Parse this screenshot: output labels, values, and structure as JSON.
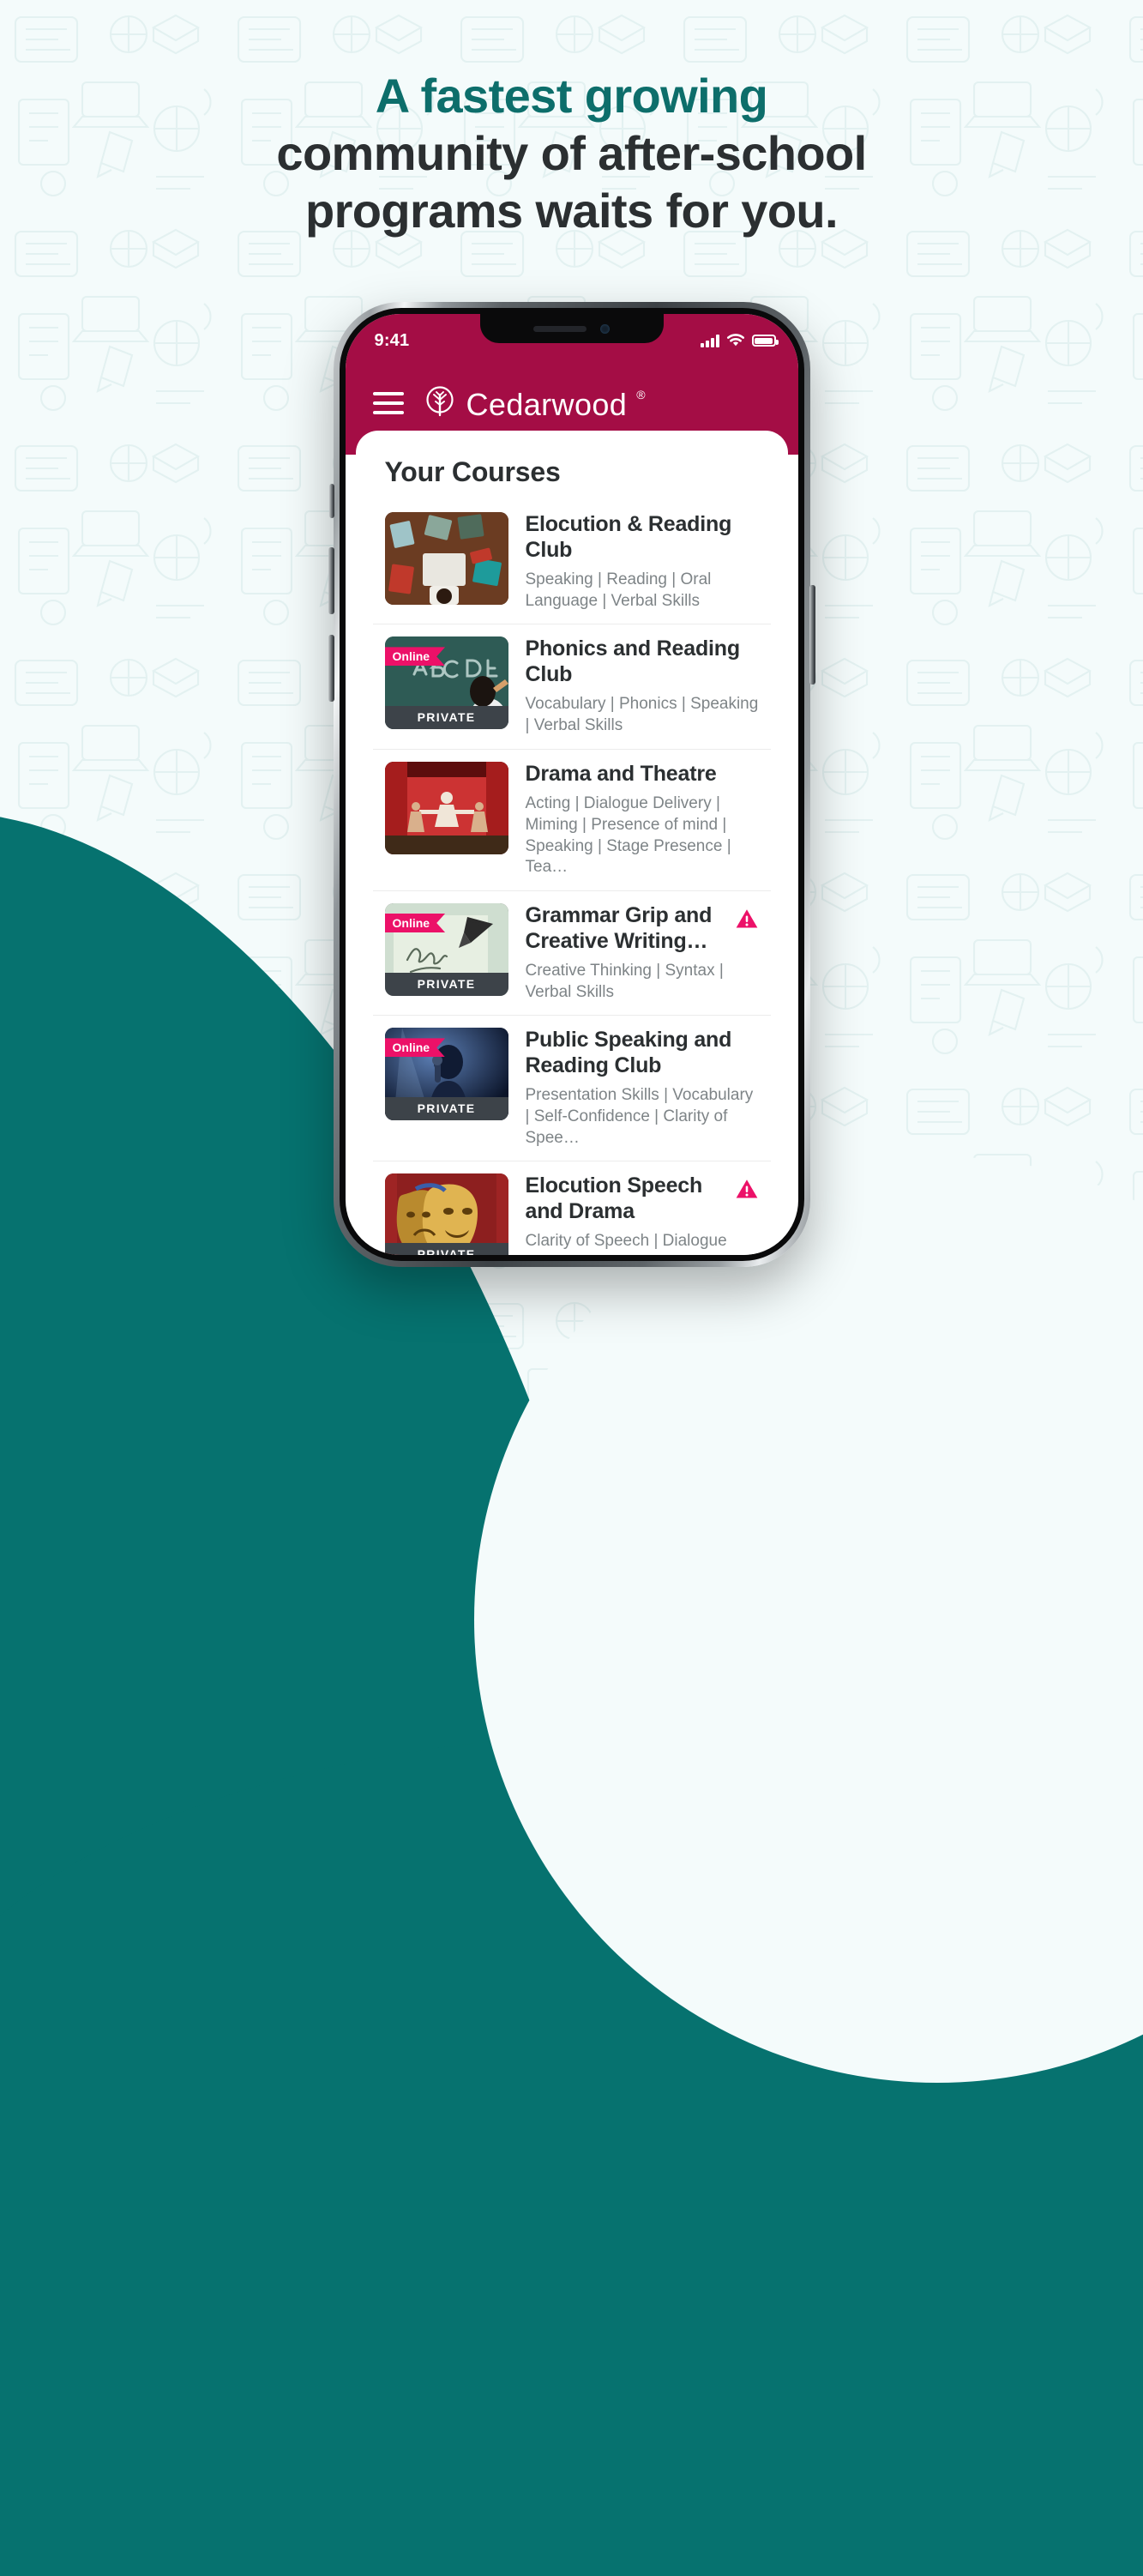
{
  "headline": {
    "line1": "A fastest growing",
    "line2": "community of after-school",
    "line3": "programs waits for you."
  },
  "colors": {
    "accent_teal": "#0d6e6b",
    "brand_maroon": "#a40d45",
    "pink": "#ec1168",
    "background": "#f4fbfb",
    "text_dark": "#2b2f31",
    "text_muted": "#7e8487",
    "private_badge": "#3d4349"
  },
  "phone": {
    "status": {
      "time": "9:41",
      "signal_icon": "signal-bars-icon",
      "wifi_icon": "wifi-icon",
      "battery_icon": "battery-full-icon"
    },
    "header": {
      "menu_icon": "hamburger-menu-icon",
      "logo_icon": "cedarwood-tree-logo-icon",
      "brand": "Cedarwood",
      "registered_mark": "®"
    },
    "screen": {
      "section_title": "Your Courses",
      "courses": [
        {
          "title": "Elocution & Reading Club",
          "tags": "Speaking | Reading | Oral Language | Verbal Skills",
          "online_badge": "",
          "private_badge": "",
          "warning": false,
          "thumb": "students-reading-books-top-view"
        },
        {
          "title": "Phonics and Reading Club",
          "tags": "Vocabulary | Phonics | Speaking | Verbal Skills",
          "online_badge": "Online",
          "private_badge": "PRIVATE",
          "warning": false,
          "thumb": "child-writing-abcd-on-chalkboard"
        },
        {
          "title": "Drama and Theatre",
          "tags": "Acting | Dialogue Delivery | Miming | Presence of mind | Speaking | Stage Presence | Tea…",
          "online_badge": "",
          "private_badge": "",
          "warning": false,
          "thumb": "children-performing-on-red-stage"
        },
        {
          "title": "Grammar Grip and Creative Writing…",
          "tags": "Creative Thinking | Syntax | Verbal Skills",
          "online_badge": "Online",
          "private_badge": "PRIVATE",
          "warning": true,
          "thumb": "be-creative-handwritten-note"
        },
        {
          "title": "Public Speaking and Reading Club",
          "tags": "Presentation Skills | Vocabulary | Self-Confidence | Clarity of Spee…",
          "online_badge": "Online",
          "private_badge": "PRIVATE",
          "warning": false,
          "thumb": "speaker-at-microphone-spotlight"
        },
        {
          "title": "Elocution Speech and Drama",
          "tags": "Clarity of Speech | Dialogue Delivery | Innovation | Speaking…",
          "online_badge": "",
          "private_badge": "PRIVATE",
          "warning": true,
          "thumb": "golden-theatre-masks"
        }
      ]
    }
  }
}
